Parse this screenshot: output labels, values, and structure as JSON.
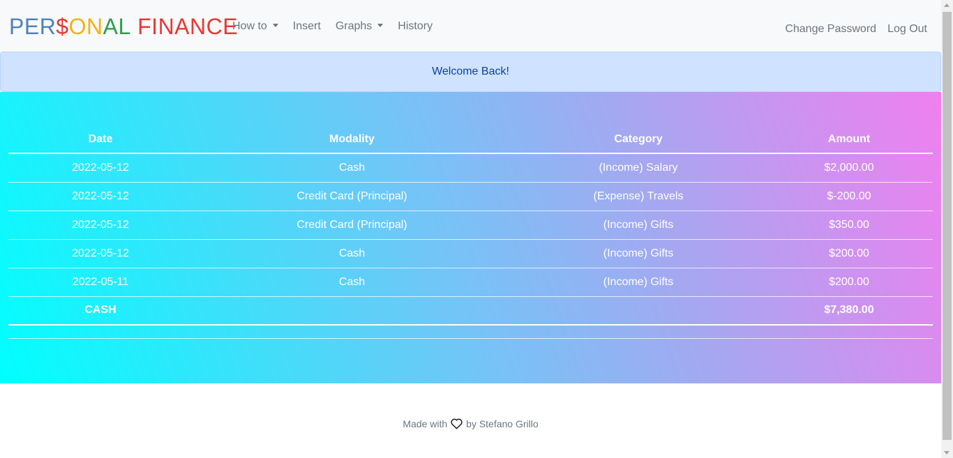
{
  "navbar": {
    "brand": [
      {
        "text": "PER",
        "color": "#4f81bd"
      },
      {
        "text": "$",
        "color": "#e53935"
      },
      {
        "text": "O",
        "color": "#f2b211"
      },
      {
        "text": "N",
        "color": "#f2b211"
      },
      {
        "text": "AL",
        "color": "#2e9e4f"
      },
      {
        "text": " FINANCE",
        "color": "#e53935"
      }
    ],
    "items": {
      "how_to": "How to",
      "insert": "Insert",
      "graphs": "Graphs",
      "history": "History"
    },
    "right": {
      "change_password": "Change Password",
      "log_out": "Log Out"
    }
  },
  "alert": {
    "message": "Welcome Back!"
  },
  "table": {
    "headers": {
      "date": "Date",
      "modality": "Modality",
      "category": "Category",
      "amount": "Amount"
    },
    "rows": [
      {
        "date": "2022-05-12",
        "modality": "Cash",
        "category": "(Income) Salary",
        "amount": "$2,000.00"
      },
      {
        "date": "2022-05-12",
        "modality": "Credit Card (Principal)",
        "category": "(Expense) Travels",
        "amount": "$-200.00"
      },
      {
        "date": "2022-05-12",
        "modality": "Credit Card (Principal)",
        "category": "(Income) Gifts",
        "amount": "$350.00"
      },
      {
        "date": "2022-05-12",
        "modality": "Cash",
        "category": "(Income) Gifts",
        "amount": "$200.00"
      },
      {
        "date": "2022-05-11",
        "modality": "Cash",
        "category": "(Income) Gifts",
        "amount": "$200.00"
      }
    ],
    "total": {
      "label": "CASH",
      "amount": "$7,380.00"
    }
  },
  "footer": {
    "made_with": "Made with",
    "icon": "heart-icon",
    "by": "by Stefano Grillo"
  }
}
